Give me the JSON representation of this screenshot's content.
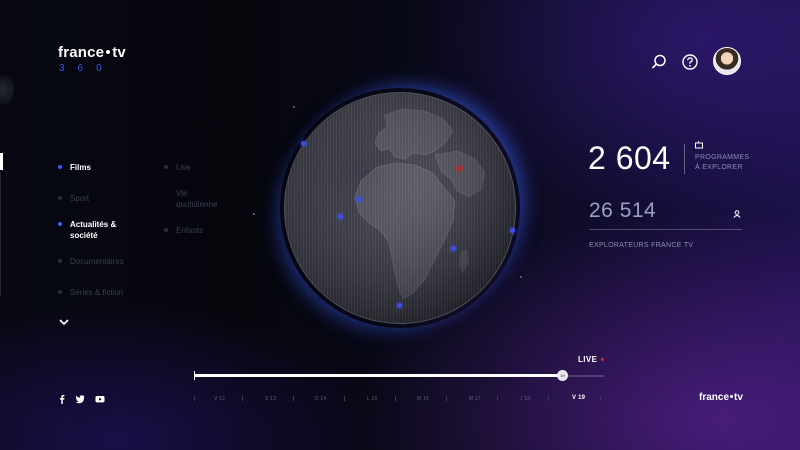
{
  "brand": {
    "name_left": "france",
    "name_right": "tv",
    "sub": "360"
  },
  "menu": {
    "col1": [
      {
        "label": "Films",
        "active": true
      },
      {
        "label": "Sport",
        "active": false
      },
      {
        "label": "Actualités & société",
        "active": true
      },
      {
        "label": "Documentaires",
        "active": false
      },
      {
        "label": "Séries & fiction",
        "active": false
      }
    ],
    "col2": [
      {
        "label": "Live",
        "active": false
      },
      {
        "label": "Vie quotidienne",
        "active": false
      },
      {
        "label": "Enfants",
        "active": false
      }
    ]
  },
  "header": {
    "search_icon": "search-icon",
    "help_icon": "help-icon",
    "avatar": "user-avatar"
  },
  "stats": {
    "programs": {
      "value": "2 604",
      "label_line1": "PROGRAMMES",
      "label_line2": "À EXPLORER"
    },
    "explorers": {
      "value": "26 514",
      "label": "EXPLORATEURS FRANCE TV"
    }
  },
  "timeline": {
    "live_label": "LIVE",
    "knob_label": "19",
    "progress": 0.9,
    "days": [
      "V 12",
      "S 13",
      "D 14",
      "L 15",
      "M 16",
      "M 17",
      "J 18",
      "V 19"
    ],
    "current_day": "V 19"
  },
  "footer": {
    "social": [
      "facebook-icon",
      "twitter-icon",
      "youtube-icon"
    ],
    "logo_left": "france",
    "logo_right": "tv"
  },
  "colors": {
    "accent_blue": "#3f57f0",
    "live_red": "#e02525",
    "background_dark": "#05060c",
    "background_purple": "#1b1048"
  }
}
